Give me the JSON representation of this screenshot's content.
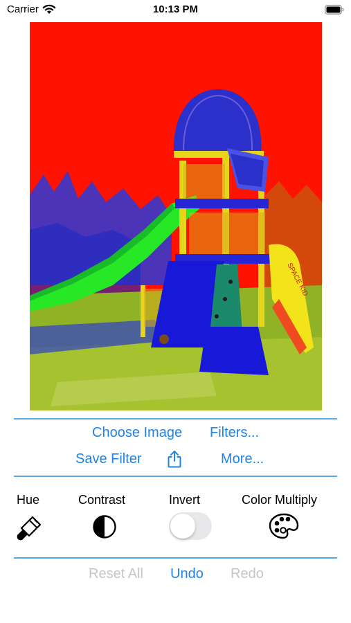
{
  "status_bar": {
    "carrier": "Carrier",
    "time": "10:13 PM"
  },
  "photo": {
    "slide_text": "SPACE KID"
  },
  "actions": {
    "choose_image": "Choose Image",
    "filters": "Filters...",
    "save_filter": "Save Filter",
    "more": "More..."
  },
  "tools": {
    "hue": "Hue",
    "contrast": "Contrast",
    "invert": "Invert",
    "color_multiply": "Color Multiply",
    "invert_on": false
  },
  "history": {
    "reset_all": "Reset All",
    "undo": "Undo",
    "redo": "Redo"
  },
  "colors": {
    "accent": "#1e84e6",
    "disabled": "#c5c5c5",
    "divider": "#57a7e4"
  }
}
